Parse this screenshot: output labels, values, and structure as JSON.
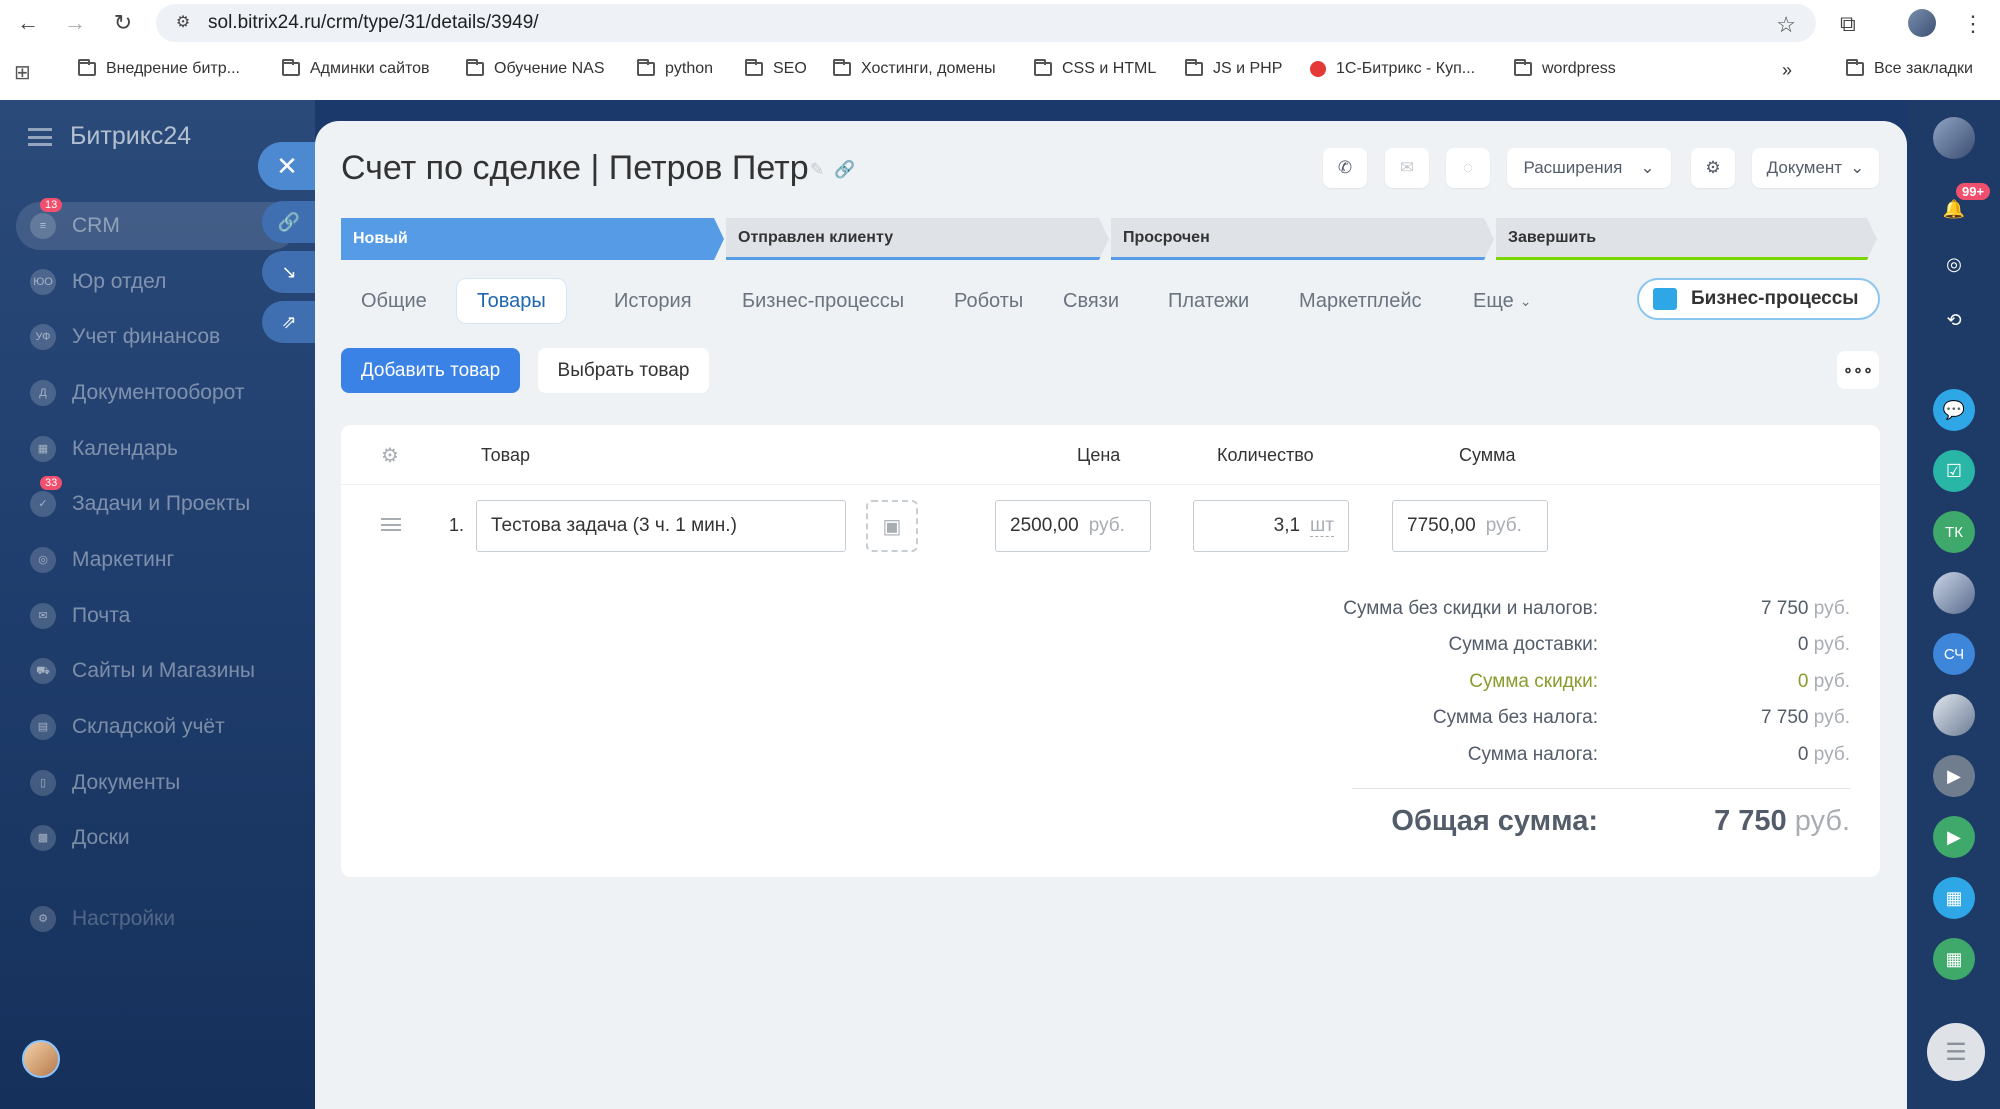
{
  "browser": {
    "url": "sol.bitrix24.ru/crm/type/31/details/3949/",
    "bookmarks": [
      "Внедрение битр...",
      "Админки сайтов",
      "Обучение NAS",
      "python",
      "SEO",
      "Хостинги, домены",
      "CSS и HTML",
      "JS и PHP",
      "1С-Битрикс - Куп...",
      "wordpress"
    ],
    "all_bookmarks": "Все закладки"
  },
  "sidebar": {
    "title": "Битрикс24",
    "items": [
      {
        "label": "CRM",
        "icon": "funnel-icon",
        "badge": "13"
      },
      {
        "label": "Юр отдел",
        "icon": "ЮО"
      },
      {
        "label": "Учет финансов",
        "icon": "УФ"
      },
      {
        "label": "Документооборот",
        "icon": "Д"
      },
      {
        "label": "Календарь",
        "icon": "calendar-icon"
      },
      {
        "label": "Задачи и Проекты",
        "icon": "tasks-icon",
        "badge": "33"
      },
      {
        "label": "Маркетинг",
        "icon": "marketing-icon"
      },
      {
        "label": "Почта",
        "icon": "mail-icon"
      },
      {
        "label": "Сайты и Магазины",
        "icon": "cart-icon"
      },
      {
        "label": "Складской учёт",
        "icon": "warehouse-icon"
      },
      {
        "label": "Документы",
        "icon": "docs-icon"
      },
      {
        "label": "Доски",
        "icon": "boards-icon"
      },
      {
        "label": "Настройки",
        "icon": "settings-icon"
      }
    ]
  },
  "header": {
    "title": "Счет по сделке | Петров Петр",
    "extensions": "Расширения",
    "document": "Документ"
  },
  "stages": [
    "Новый",
    "Отправлен клиенту",
    "Просрочен",
    "Завершить"
  ],
  "tabs": [
    "Общие",
    "Товары",
    "История",
    "Бизнес-процессы",
    "Роботы",
    "Связи",
    "Платежи",
    "Маркетплейс",
    "Еще"
  ],
  "active_tab": "Товары",
  "bp_button": "Бизнес-процессы",
  "actions": {
    "add": "Добавить товар",
    "select": "Выбрать товар"
  },
  "table": {
    "headers": {
      "product": "Товар",
      "price": "Цена",
      "qty": "Количество",
      "sum": "Сумма"
    },
    "rows": [
      {
        "num": "1.",
        "name": "Тестова задача (3 ч. 1 мин.)",
        "price": "2500,00",
        "price_cur": "руб.",
        "qty": "3,1",
        "unit": "шт",
        "sum": "7750,00",
        "sum_cur": "руб."
      }
    ]
  },
  "summary": [
    {
      "label": "Сумма без скидки и налогов:",
      "value": "7 750",
      "cur": "руб."
    },
    {
      "label": "Сумма доставки:",
      "value": "0",
      "cur": "руб."
    },
    {
      "label": "Сумма скидки:",
      "value": "0",
      "cur": "руб.",
      "highlight": true
    },
    {
      "label": "Сумма без налога:",
      "value": "7 750",
      "cur": "руб."
    },
    {
      "label": "Сумма налога:",
      "value": "0",
      "cur": "руб."
    }
  ],
  "total": {
    "label": "Общая сумма:",
    "value": "7 750",
    "cur": "руб."
  },
  "rail": {
    "notifications_badge": "99+",
    "tk": "ТК",
    "sch": "СЧ"
  }
}
